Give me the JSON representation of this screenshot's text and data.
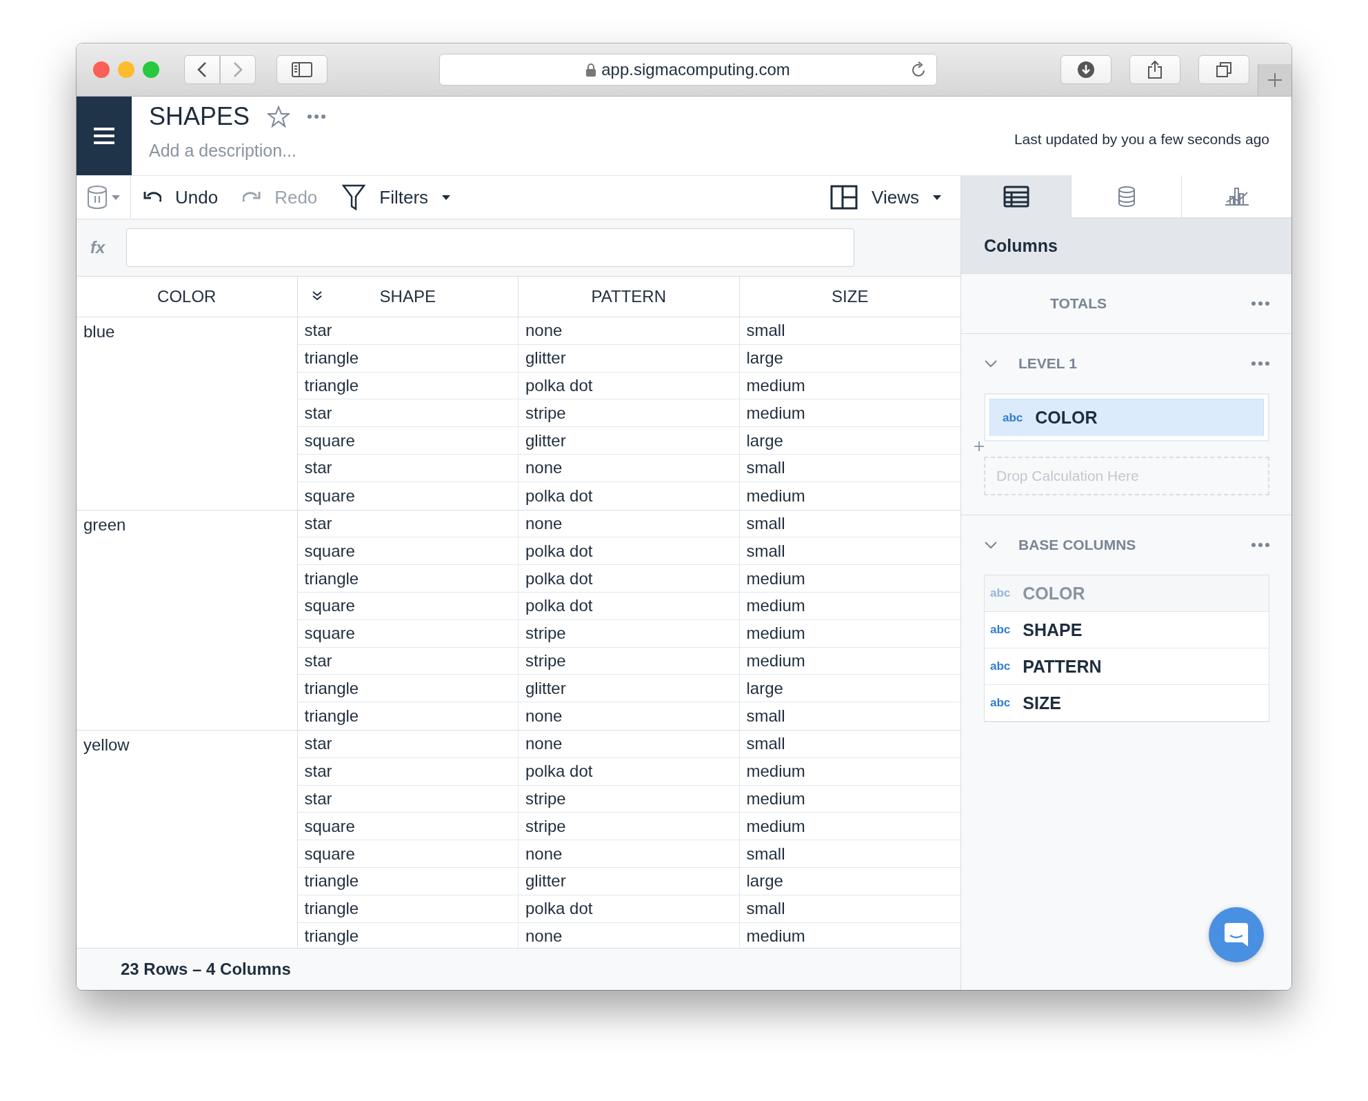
{
  "browser": {
    "url": "app.sigmacomputing.com"
  },
  "header": {
    "title": "SHAPES",
    "description_placeholder": "Add a description...",
    "last_updated": "Last updated by you a few seconds ago"
  },
  "toolbar": {
    "undo": "Undo",
    "redo": "Redo",
    "redo_disabled": true,
    "filters": "Filters",
    "views": "Views"
  },
  "formula_bar": {
    "label": "fx"
  },
  "table": {
    "columns": [
      {
        "label": "COLOR",
        "kind": "plain"
      },
      {
        "label": "SHAPE",
        "kind": "collapse"
      },
      {
        "label": "PATTERN",
        "kind": "plain"
      },
      {
        "label": "SIZE",
        "kind": "plain"
      }
    ],
    "groups": [
      {
        "value": "blue",
        "rows": [
          [
            "star",
            "none",
            "small"
          ],
          [
            "triangle",
            "glitter",
            "large"
          ],
          [
            "triangle",
            "polka dot",
            "medium"
          ],
          [
            "star",
            "stripe",
            "medium"
          ],
          [
            "square",
            "glitter",
            "large"
          ],
          [
            "star",
            "none",
            "small"
          ],
          [
            "square",
            "polka dot",
            "medium"
          ]
        ]
      },
      {
        "value": "green",
        "rows": [
          [
            "star",
            "none",
            "small"
          ],
          [
            "square",
            "polka dot",
            "small"
          ],
          [
            "triangle",
            "polka dot",
            "medium"
          ],
          [
            "square",
            "polka dot",
            "medium"
          ],
          [
            "square",
            "stripe",
            "medium"
          ],
          [
            "star",
            "stripe",
            "medium"
          ],
          [
            "triangle",
            "glitter",
            "large"
          ],
          [
            "triangle",
            "none",
            "small"
          ]
        ]
      },
      {
        "value": "yellow",
        "rows": [
          [
            "star",
            "none",
            "small"
          ],
          [
            "star",
            "polka dot",
            "medium"
          ],
          [
            "star",
            "stripe",
            "medium"
          ],
          [
            "square",
            "stripe",
            "medium"
          ],
          [
            "square",
            "none",
            "small"
          ],
          [
            "triangle",
            "glitter",
            "large"
          ],
          [
            "triangle",
            "polka dot",
            "small"
          ],
          [
            "triangle",
            "none",
            "medium"
          ]
        ]
      }
    ]
  },
  "status_bar": "23 Rows – 4 Columns",
  "panel": {
    "tabs": [
      {
        "kind": "table",
        "selected": true
      },
      {
        "kind": "database",
        "selected": false
      },
      {
        "kind": "chart",
        "selected": false
      }
    ],
    "title": "Columns",
    "totals": "TOTALS",
    "level": {
      "label": "LEVEL 1",
      "expanded": true,
      "items": [
        {
          "type": "abc",
          "name": "COLOR",
          "selected": true
        }
      ],
      "drop_placeholder": "Drop Calculation Here"
    },
    "base": {
      "label": "BASE COLUMNS",
      "expanded": true,
      "items": [
        {
          "type": "abc",
          "name": "COLOR",
          "disabled": true
        },
        {
          "type": "abc",
          "name": "SHAPE",
          "disabled": false
        },
        {
          "type": "abc",
          "name": "PATTERN",
          "disabled": false
        },
        {
          "type": "abc",
          "name": "SIZE",
          "disabled": false
        }
      ]
    }
  }
}
